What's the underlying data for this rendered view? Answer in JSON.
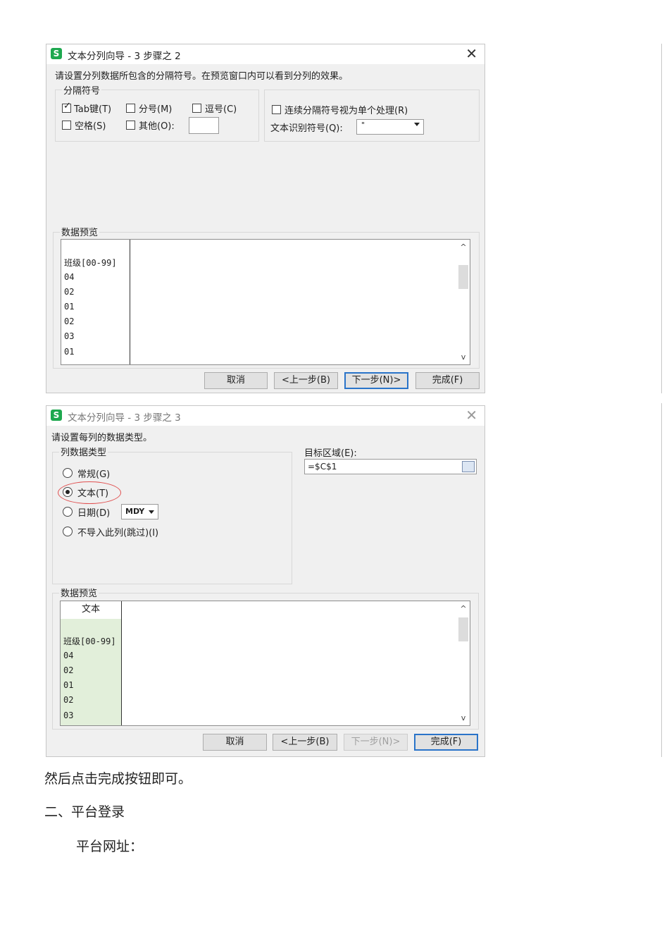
{
  "dialog1": {
    "title": "文本分列向导 - 3 步骤之 2",
    "instruction": "请设置分列数据所包含的分隔符号。在预览窗口内可以看到分列的效果。",
    "delimiters": {
      "legend": "分隔符号",
      "tab": "Tab键(T)",
      "semicolon": "分号(M)",
      "comma": "逗号(C)",
      "space": "空格(S)",
      "other": "其他(O):"
    },
    "consecutive": "连续分隔符号视为单个处理(R)",
    "qualifier_label": "文本识别符号(Q):",
    "qualifier_value": "\"",
    "preview_legend": "数据预览",
    "preview_rows": [
      "班级[00-99]",
      "04",
      "02",
      "01",
      "02",
      "03",
      "01"
    ],
    "buttons": {
      "cancel": "取消",
      "back": "<上一步(B)",
      "next": "下一步(N)>",
      "finish": "完成(F)"
    }
  },
  "dialog2": {
    "title": "文本分列向导 - 3 步骤之 3",
    "instruction": "请设置每列的数据类型。",
    "column_type_legend": "列数据类型",
    "options": {
      "general": "常规(G)",
      "text": "文本(T)",
      "date": "日期(D)",
      "skip": "不导入此列(跳过)(I)"
    },
    "date_format": "MDY",
    "target_label": "目标区域(E):",
    "target_value": "=$C$1",
    "preview_legend": "数据预览",
    "preview_header": "文本",
    "preview_rows": [
      "班级[00-99]",
      "04",
      "02",
      "01",
      "02",
      "03"
    ],
    "buttons": {
      "cancel": "取消",
      "back": "<上一步(B)",
      "next": "下一步(N)>",
      "finish": "完成(F)"
    }
  },
  "doc": {
    "line1": "然后点击完成按钮即可。",
    "line2": "二、平台登录",
    "line3": "平台网址："
  },
  "colors": {
    "logo": "#1ea84f",
    "highlight_column": "#e2efda",
    "annotation_circle": "#e05050",
    "primary_border": "#2a74c9"
  }
}
